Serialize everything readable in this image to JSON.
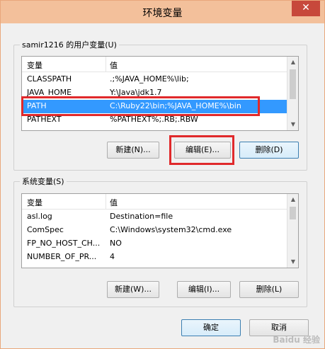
{
  "window": {
    "title": "环境变量",
    "close_symbol": "✕"
  },
  "user_vars": {
    "label": "samir1216 的用户变量(U)",
    "columns": [
      "变量",
      "值"
    ],
    "rows": [
      {
        "name": "CLASSPATH",
        "value": ".;%JAVA_HOME%\\lib;"
      },
      {
        "name": "JAVA_HOME",
        "value": "Y:\\Java\\jdk1.7"
      },
      {
        "name": "PATH",
        "value": "C:\\Ruby22\\bin;%JAVA_HOME%\\bin"
      },
      {
        "name": "PATHEXT",
        "value": "%PATHEXT%;.RB;.RBW"
      }
    ],
    "selected_index": 2,
    "buttons": {
      "new": "新建(N)...",
      "edit": "编辑(E)...",
      "delete": "删除(D)"
    }
  },
  "system_vars": {
    "label": "系统变量(S)",
    "columns": [
      "变量",
      "值"
    ],
    "rows": [
      {
        "name": "asl.log",
        "value": "Destination=file"
      },
      {
        "name": "ComSpec",
        "value": "C:\\Windows\\system32\\cmd.exe"
      },
      {
        "name": "FP_NO_HOST_CH...",
        "value": "NO"
      },
      {
        "name": "NUMBER_OF_PR...",
        "value": "4"
      }
    ],
    "buttons": {
      "new": "新建(W)...",
      "edit": "编辑(I)...",
      "delete": "删除(L)"
    }
  },
  "footer": {
    "ok": "确定",
    "cancel": "取消"
  },
  "watermark": "Baidu 经验",
  "colors": {
    "selection": "#3399ff",
    "highlight_box": "#e0292b",
    "titlebar": "#f3c09b",
    "close": "#c7483b"
  }
}
